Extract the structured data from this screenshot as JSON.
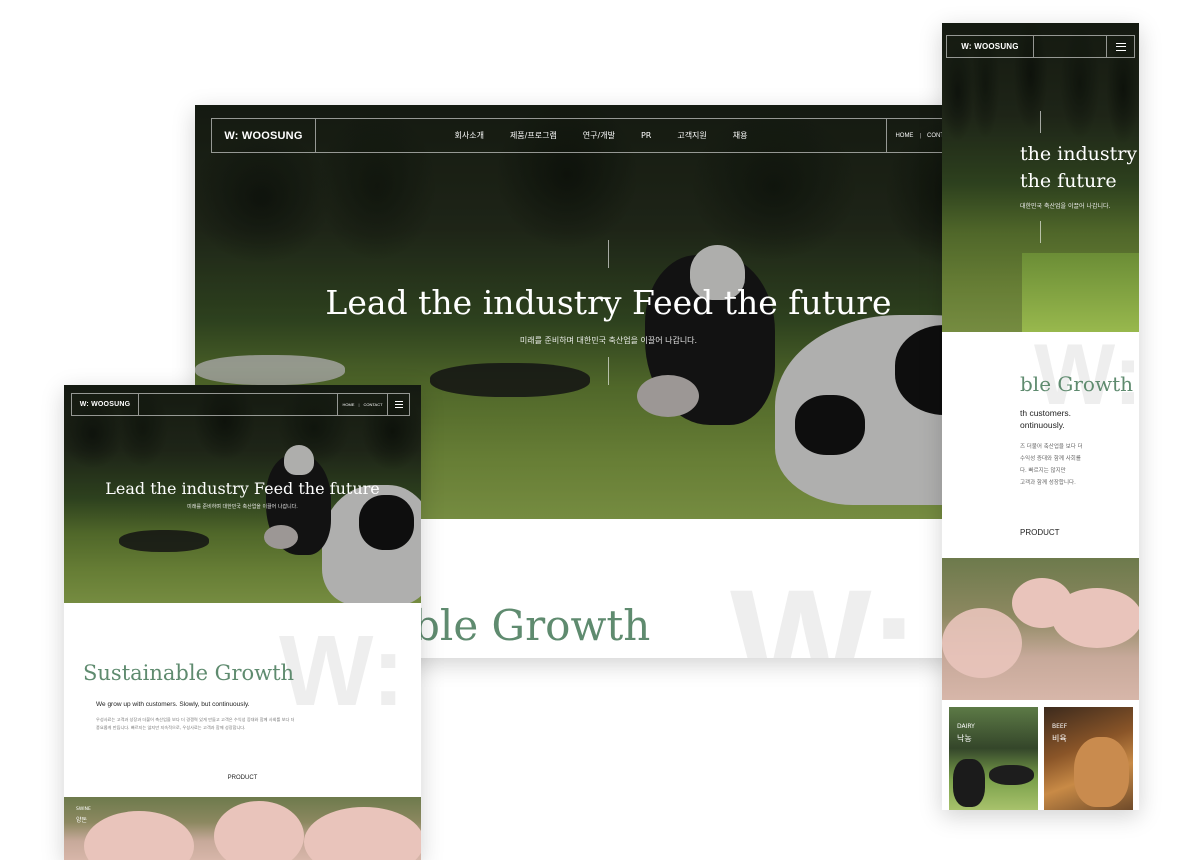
{
  "brand": {
    "logo": "W: WOOSUNG"
  },
  "nav": {
    "items": [
      "회사소개",
      "제품/프로그램",
      "연구/개발",
      "PR",
      "고객지원",
      "채용"
    ],
    "home": "HOME",
    "separator": "|",
    "contact": "CONTACT"
  },
  "hero": {
    "title": "Lead the industry Feed the future",
    "subtitle": "미래를 준비하며 대한민국 축산업을 이끌어 나갑니다."
  },
  "desktop_section": {
    "growth_partial": "ble Growth"
  },
  "mobile_right": {
    "hero_title_line1": "the industry",
    "hero_title_line2": "the future",
    "hero_sub_partial": "대한민국 축산업을 이끌어 나갑니다.",
    "growth_partial": "ble Growth",
    "intro_line1": "th customers.",
    "intro_line2": "ontinuously.",
    "body_lines": [
      "즈 더불어 축산업을 보다 더",
      "수익성 증대와 함께 사회를",
      "다. 빠르지는 않지만",
      "고객과 함께 성장합니다."
    ],
    "product_label": "PRODUCT",
    "cards": [
      {
        "en": "DAIRY",
        "ko": "낙농"
      },
      {
        "en": "BEEF",
        "ko": "비육"
      }
    ]
  },
  "tablet": {
    "growth_title": "Sustainable Growth",
    "intro": "We grow up with customers. Slowly, but continuously.",
    "body_line1": "우성사료는 고객과 성장과 더불어 축산업을 보다 더 경쟁력 있게 만들고 고객은 수익성 증대와 함께 사회를 보다 더",
    "body_line2": "풍요롭게 만듭니다. 빠르지는 않지만 지속적으로, 우성사료는 고객과 함께 성장합니다.",
    "product_label": "PRODUCT",
    "swine_en": "SWINE",
    "swine_ko": "양돈"
  },
  "watermark": "W:"
}
